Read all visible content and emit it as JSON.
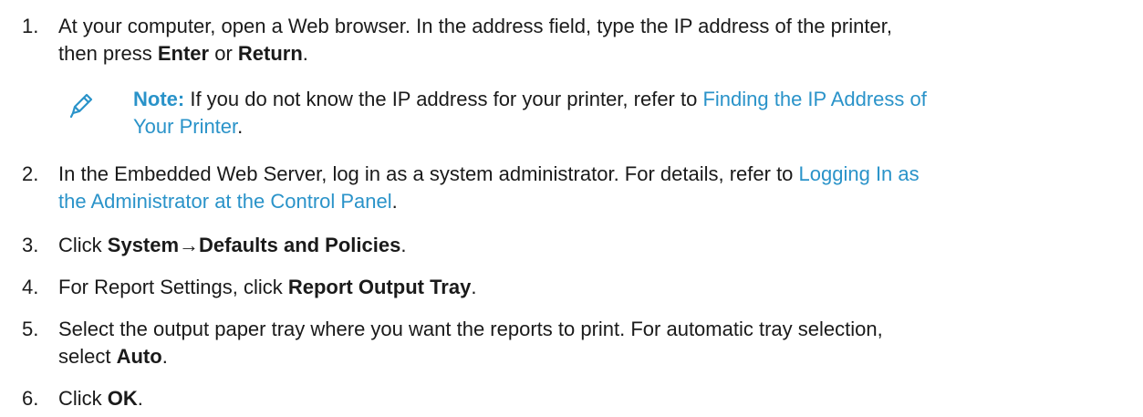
{
  "steps": [
    {
      "number": "1.",
      "line1": "At your computer, open a Web browser. In the address field, type the IP address of the printer,",
      "line2_prefix": "then press ",
      "enter": "Enter",
      "or": " or ",
      "return": "Return",
      "end": "."
    },
    {
      "number": "2.",
      "line1_prefix": "In the Embedded Web Server, log in as a system administrator. For details, refer to ",
      "link_part1": "Logging In as",
      "link_part2": "the Administrator at the Control Panel",
      "end": "."
    },
    {
      "number": "3.",
      "prefix": "Click ",
      "bold": "System→Defaults and Policies",
      "end": "."
    },
    {
      "number": "4.",
      "prefix": "For Report Settings, click ",
      "bold": "Report Output Tray",
      "end": "."
    },
    {
      "number": "5.",
      "line1": "Select the output paper tray where you want the reports to print. For automatic tray selection,",
      "line2_prefix": "select ",
      "bold": "Auto",
      "end": "."
    },
    {
      "number": "6.",
      "prefix": "Click ",
      "bold": "OK",
      "end": "."
    }
  ],
  "note": {
    "label": "Note:",
    "text": " If you do not know the IP address for your printer, refer to ",
    "link_part1": "Finding the IP Address of",
    "link_part2": "Your Printer",
    "end": ".",
    "icon": "pencil-icon"
  },
  "colors": {
    "text": "#1a1a1a",
    "accent": "#2a93c9"
  }
}
